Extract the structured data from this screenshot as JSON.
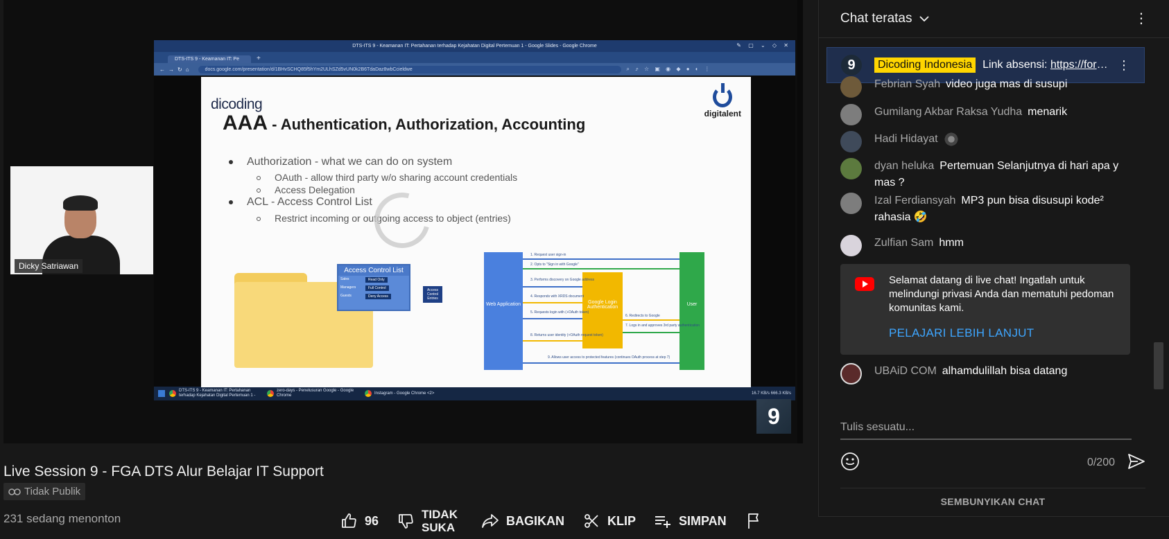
{
  "video": {
    "title": "Live Session 9 - FGA DTS Alur Belajar IT Support",
    "visibility": "Tidak Publik",
    "viewers": "231 sedang menonton",
    "presenter_name": "Dicky Satriawan",
    "channel_logo_text": "9",
    "actions": {
      "like_count": "96",
      "dislike_line1": "TIDAK",
      "dislike_line2": "SUKA",
      "share_label": "BAGIKAN",
      "clip_label": "KLIP",
      "save_label": "SIMPAN"
    }
  },
  "screen_share": {
    "window_title": "DTS-ITS 9 - Keamanan IT: Pertahanan terhadap Kejahatan Digital Pertemuan 1 - Google Slides - Google Chrome",
    "tab_label": "DTS-ITS 9 - Keamanan IT: Pe",
    "url": "docs.google.com/presentation/d/1BHvSCHQ85f5hYm2ULhSZd5vUN0k2B6TdaDaz8wbCcieldwe",
    "taskbar": [
      "DTS-ITS 9 - Keamanan IT: Pertahanan terhadap Kejahatan Digital Pertemuan 1 -",
      "zero-days - Penelusuran Google - Google Chrome",
      "Instagram - Google Chrome <2>"
    ],
    "tray_text": "16.7 KB/s  666.3 KB/s"
  },
  "slide": {
    "brand": "dicoding",
    "logo_name": "digitalent",
    "title_big": "AAA",
    "title_rest": " - Authentication, Authorization, Accounting",
    "bullets": [
      "Authorization - what we can do on system",
      "OAuth - allow third party w/o sharing account credentials",
      "Access Delegation",
      "ACL - Access Control List",
      "Restrict incoming or outgoing access to object (entries)"
    ],
    "acl_title": "Access Control List",
    "acl_rows": [
      [
        "Sales",
        "Read Only"
      ],
      [
        "Managers",
        "Full Control"
      ],
      [
        "Guests",
        "Deny Access"
      ]
    ],
    "acl_box": "Access Control Entries",
    "web_app": "Web Application",
    "google_login": "Google Login Authentication",
    "user": "User",
    "flow": [
      "1. Request user sign-in",
      "2. Opts to \"Sign in with Google\"",
      "3. Performs discovery on Google address",
      "4. Responds with XRDS document",
      "5. Requests login with (+OAuth token)",
      "6. Redirects to Google",
      "7. Logs in and approves 3rd party authentication",
      "8. Returns user identity (+OAuth request token)",
      "9. Allows user access to protected features (continues OAuth process at step 7)"
    ]
  },
  "chat": {
    "header": "Chat teratas",
    "pinned": {
      "avatar_text": "9",
      "author": "Dicoding Indonesia",
      "text_prefix": "Link absensi: ",
      "link": "https://forms.gle"
    },
    "messages": [
      {
        "author": "Febrian Syah",
        "text": "video juga mas di susupi"
      },
      {
        "author": "Gumilang Akbar Raksa Yudha",
        "text": "menarik"
      },
      {
        "author": "Hadi Hidayat",
        "text": ""
      },
      {
        "author": "dyan heluka",
        "text": "Pertemuan Selanjutnya di hari apa y mas ?"
      },
      {
        "author": "Izal Ferdiansyah",
        "text": "MP3 pun bisa disusupi kode² rahasia 🤣"
      },
      {
        "author": "Zulfian Sam",
        "text": "hmm"
      },
      {
        "author": "UBAiD COM",
        "text": "alhamdulillah bisa datang"
      }
    ],
    "notice": {
      "text": "Selamat datang di live chat! Ingatlah untuk melindungi privasi Anda dan mematuhi pedoman komunitas kami.",
      "link": "PELAJARI LEBIH LANJUT"
    },
    "input_placeholder": "Tulis sesuatu...",
    "char_count": "0/200",
    "hide_chat": "SEMBUNYIKAN CHAT"
  },
  "colors": {
    "background": "#181818",
    "pinned_bg": "#1f2e4d",
    "highlight": "#ffd600",
    "link": "#3ea6ff",
    "youtube_red": "#ff0000"
  }
}
